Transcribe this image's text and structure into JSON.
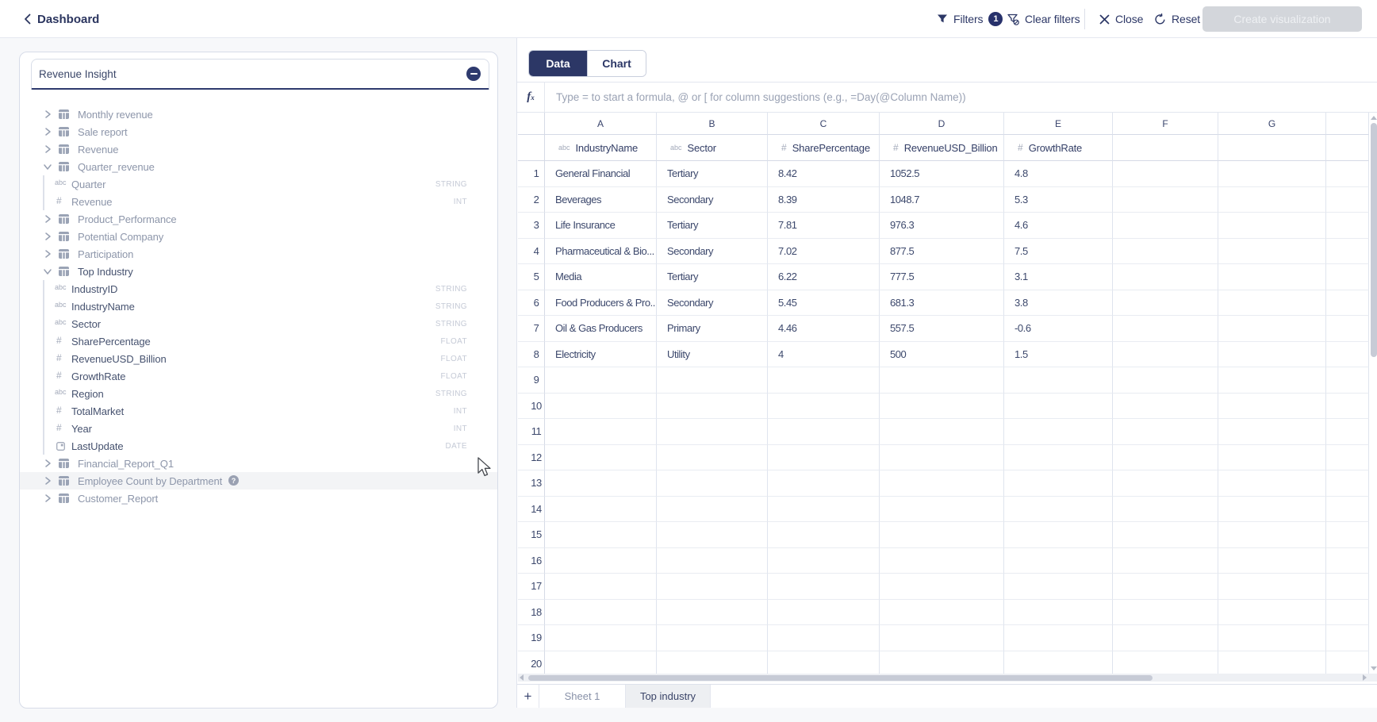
{
  "header": {
    "back_label": "Dashboard",
    "filters_label": "Filters",
    "filters_count": "1",
    "clear_filters_label": "Clear filters",
    "close_label": "Close",
    "reset_label": "Reset",
    "create_visualization_label": "Create visualization"
  },
  "colors": {
    "navy": "#2c3766",
    "badge": "#27316b",
    "disabled_button_bg": "#d3d6db",
    "active_sheet_tab_bg": "#edeff2"
  },
  "source_panel": {
    "source_input_value": "Revenue Insight",
    "tree": [
      {
        "kind": "table",
        "label": "Monthly revenue",
        "state": "collapsed"
      },
      {
        "kind": "table",
        "label": "Sale report",
        "state": "collapsed"
      },
      {
        "kind": "table",
        "label": "Revenue",
        "state": "collapsed"
      },
      {
        "kind": "table",
        "label": "Quarter_revenue",
        "state": "expanded"
      },
      {
        "kind": "field",
        "icon": "abc",
        "label": "Quarter",
        "dtype": "STRING"
      },
      {
        "kind": "field",
        "icon": "num",
        "label": "Revenue",
        "dtype": "INT"
      },
      {
        "kind": "table",
        "label": "Product_Performance",
        "state": "collapsed"
      },
      {
        "kind": "table",
        "label": "Potential Company",
        "state": "collapsed"
      },
      {
        "kind": "table",
        "label": "Participation",
        "state": "collapsed"
      },
      {
        "kind": "table",
        "label": "Top Industry",
        "state": "expanded",
        "active": true
      },
      {
        "kind": "field",
        "icon": "abc",
        "label": "IndustryID",
        "dtype": "STRING",
        "active": true
      },
      {
        "kind": "field",
        "icon": "abc",
        "label": "IndustryName",
        "dtype": "STRING",
        "active": true
      },
      {
        "kind": "field",
        "icon": "abc",
        "label": "Sector",
        "dtype": "STRING",
        "active": true
      },
      {
        "kind": "field",
        "icon": "num",
        "label": "SharePercentage",
        "dtype": "FLOAT",
        "active": true
      },
      {
        "kind": "field",
        "icon": "num",
        "label": "RevenueUSD_Billion",
        "dtype": "FLOAT",
        "active": true
      },
      {
        "kind": "field",
        "icon": "num",
        "label": "GrowthRate",
        "dtype": "FLOAT",
        "active": true
      },
      {
        "kind": "field",
        "icon": "abc",
        "label": "Region",
        "dtype": "STRING",
        "active": true
      },
      {
        "kind": "field",
        "icon": "num",
        "label": "TotalMarket",
        "dtype": "INT",
        "active": true
      },
      {
        "kind": "field",
        "icon": "num",
        "label": "Year",
        "dtype": "INT",
        "active": true
      },
      {
        "kind": "field",
        "icon": "date",
        "label": "LastUpdate",
        "dtype": "DATE",
        "active": true
      },
      {
        "kind": "table",
        "label": "Financial_Report_Q1",
        "state": "collapsed"
      },
      {
        "kind": "table",
        "label": "Employee Count by Department",
        "state": "collapsed",
        "hover": true,
        "help_badge": true
      },
      {
        "kind": "table",
        "label": "Customer_Report",
        "state": "collapsed"
      }
    ]
  },
  "workbook": {
    "view_tabs": [
      {
        "label": "Data",
        "active": true
      },
      {
        "label": "Chart",
        "active": false
      }
    ],
    "formula_placeholder": "Type = to start a formula, @ or [ for column suggestions (e.g., =Day(@Column Name))",
    "grid": {
      "column_letters": [
        "A",
        "B",
        "C",
        "D",
        "E",
        "F",
        "G"
      ],
      "fields": [
        {
          "col": "A",
          "icon": "abc",
          "label": "IndustryName"
        },
        {
          "col": "B",
          "icon": "abc",
          "label": "Sector"
        },
        {
          "col": "C",
          "icon": "num",
          "label": "SharePercentage"
        },
        {
          "col": "D",
          "icon": "num",
          "label": "RevenueUSD_Billion"
        },
        {
          "col": "E",
          "icon": "num",
          "label": "GrowthRate"
        }
      ],
      "row_count": 20,
      "rows": [
        [
          "General Financial",
          "Tertiary",
          "8.42",
          "1052.5",
          "4.8"
        ],
        [
          "Beverages",
          "Secondary",
          "8.39",
          "1048.7",
          "5.3"
        ],
        [
          "Life Insurance",
          "Tertiary",
          "7.81",
          "976.3",
          "4.6"
        ],
        [
          "Pharmaceutical & Bio...",
          "Secondary",
          "7.02",
          "877.5",
          "7.5"
        ],
        [
          "Media",
          "Tertiary",
          "6.22",
          "777.5",
          "3.1"
        ],
        [
          "Food Producers & Pro...",
          "Secondary",
          "5.45",
          "681.3",
          "3.8"
        ],
        [
          "Oil & Gas Producers",
          "Primary",
          "4.46",
          "557.5",
          "-0.6"
        ],
        [
          "Electricity",
          "Utility",
          "4",
          "500",
          "1.5"
        ]
      ]
    },
    "add_sheet_label": "+",
    "sheet_tabs": [
      {
        "label": "Sheet 1",
        "active": false
      },
      {
        "label": "Top industry",
        "active": true
      }
    ]
  }
}
